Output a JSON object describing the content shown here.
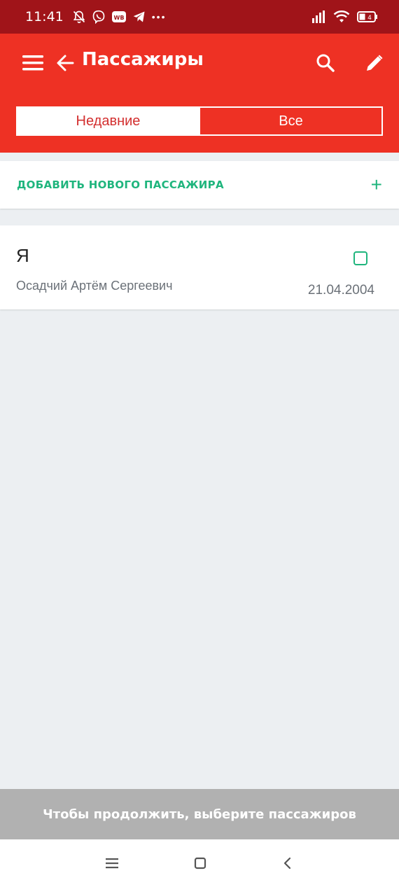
{
  "status_bar": {
    "time": "11:41",
    "notification_icons": [
      "muted-bell-icon",
      "viber-icon",
      "wb-icon",
      "telegram-icon",
      "more-dots-icon"
    ],
    "wb_label": "WB",
    "more_label": "•••",
    "right_icons": [
      "signal-icon",
      "wifi-icon",
      "battery-icon"
    ],
    "battery_text": "4"
  },
  "app_bar": {
    "title": "Пассажиры",
    "background": "#ee3124",
    "status_background": "#a01419"
  },
  "tabs": [
    {
      "label": "Недавние",
      "active": true
    },
    {
      "label": "Все",
      "active": false
    }
  ],
  "add_passenger": {
    "label": "ДОБАВИТЬ НОВОГО ПАССАЖИРА",
    "icon": "+",
    "accent": "#1fb57d"
  },
  "passengers": [
    {
      "tag": "Я",
      "name": "Осадчий Артём Сергеевич",
      "birth_date": "21.04.2004",
      "selected": false
    }
  ],
  "bottom_banner": {
    "text": "Чтобы продолжить, выберите пассажиров"
  },
  "nav_bar": {
    "buttons": [
      "menu-icon",
      "home-icon",
      "back-icon"
    ]
  }
}
